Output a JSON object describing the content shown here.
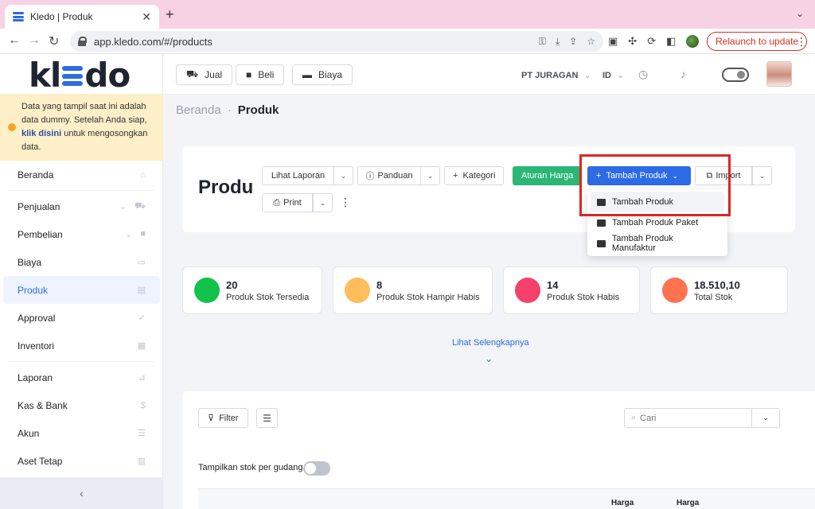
{
  "browser": {
    "tab_title": "Kledo | Produk",
    "url": "app.kledo.com/#/products",
    "relaunch_label": "Relaunch to update"
  },
  "sidebar": {
    "logo_text_left": "kl",
    "logo_text_right": "do",
    "notice": {
      "text_before": "Data yang tampil saat ini adalah data dummy. Setelah Anda siap,",
      "link": "klik disini",
      "text_after": "untuk mengosongkan data."
    },
    "items": [
      {
        "label": "Beranda",
        "icon": "home-icon"
      },
      {
        "label": "Penjualan",
        "icon": "basket-icon"
      },
      {
        "label": "Pembelian",
        "icon": "bag-icon"
      },
      {
        "label": "Biaya",
        "icon": "card-icon"
      },
      {
        "label": "Produk",
        "icon": "box-icon"
      },
      {
        "label": "Approval",
        "icon": "check-icon"
      },
      {
        "label": "Inventori",
        "icon": "warehouse-icon"
      },
      {
        "label": "Laporan",
        "icon": "chart-icon"
      },
      {
        "label": "Kas & Bank",
        "icon": "dollar-icon"
      },
      {
        "label": "Akun",
        "icon": "list-icon"
      },
      {
        "label": "Aset Tetap",
        "icon": "building-icon"
      }
    ],
    "collapse_icon": "chevron-left-icon"
  },
  "topbar": {
    "quick_buttons": [
      {
        "label": "Jual",
        "icon": "basket-icon"
      },
      {
        "label": "Beli",
        "icon": "bag-icon"
      },
      {
        "label": "Biaya",
        "icon": "card-icon"
      }
    ],
    "company": "PT JURAGAN",
    "language": "ID"
  },
  "breadcrumb": {
    "home": "Beranda",
    "separator": "·",
    "current": "Produk"
  },
  "page": {
    "title": "Produ",
    "toolbar": {
      "lihat_laporan": "Lihat Laporan",
      "panduan": "Panduan",
      "kategori": "Kategori",
      "aturan_harga": "Aturan Harga",
      "tambah_produk": "Tambah Produk",
      "import": "Import",
      "print": "Print"
    },
    "dropdown": [
      "Tambah Produk",
      "Tambah Produk Paket",
      "Tambah Produk Manufaktur"
    ]
  },
  "stats": [
    {
      "value": "20",
      "label": "Produk Stok Tersedia",
      "color": "#12c24a"
    },
    {
      "value": "8",
      "label": "Produk Stok Hampir Habis",
      "color": "#ffbd5c"
    },
    {
      "value": "14",
      "label": "Produk Stok Habis",
      "color": "#f5416b"
    },
    {
      "value": "18.510,10",
      "label": "Total Stok",
      "color": "#ff7350"
    }
  ],
  "more_link": "Lihat Selengkapnya",
  "table_controls": {
    "filter": "Filter",
    "search_placeholder": "Cari",
    "stock_toggle_label": "Tampilkan stok per gudang"
  },
  "table_headers": [
    "Harga",
    "Harga"
  ],
  "colors": {
    "accent": "#2d6be4",
    "green": "#2bb673",
    "highlight": "#e02424"
  }
}
